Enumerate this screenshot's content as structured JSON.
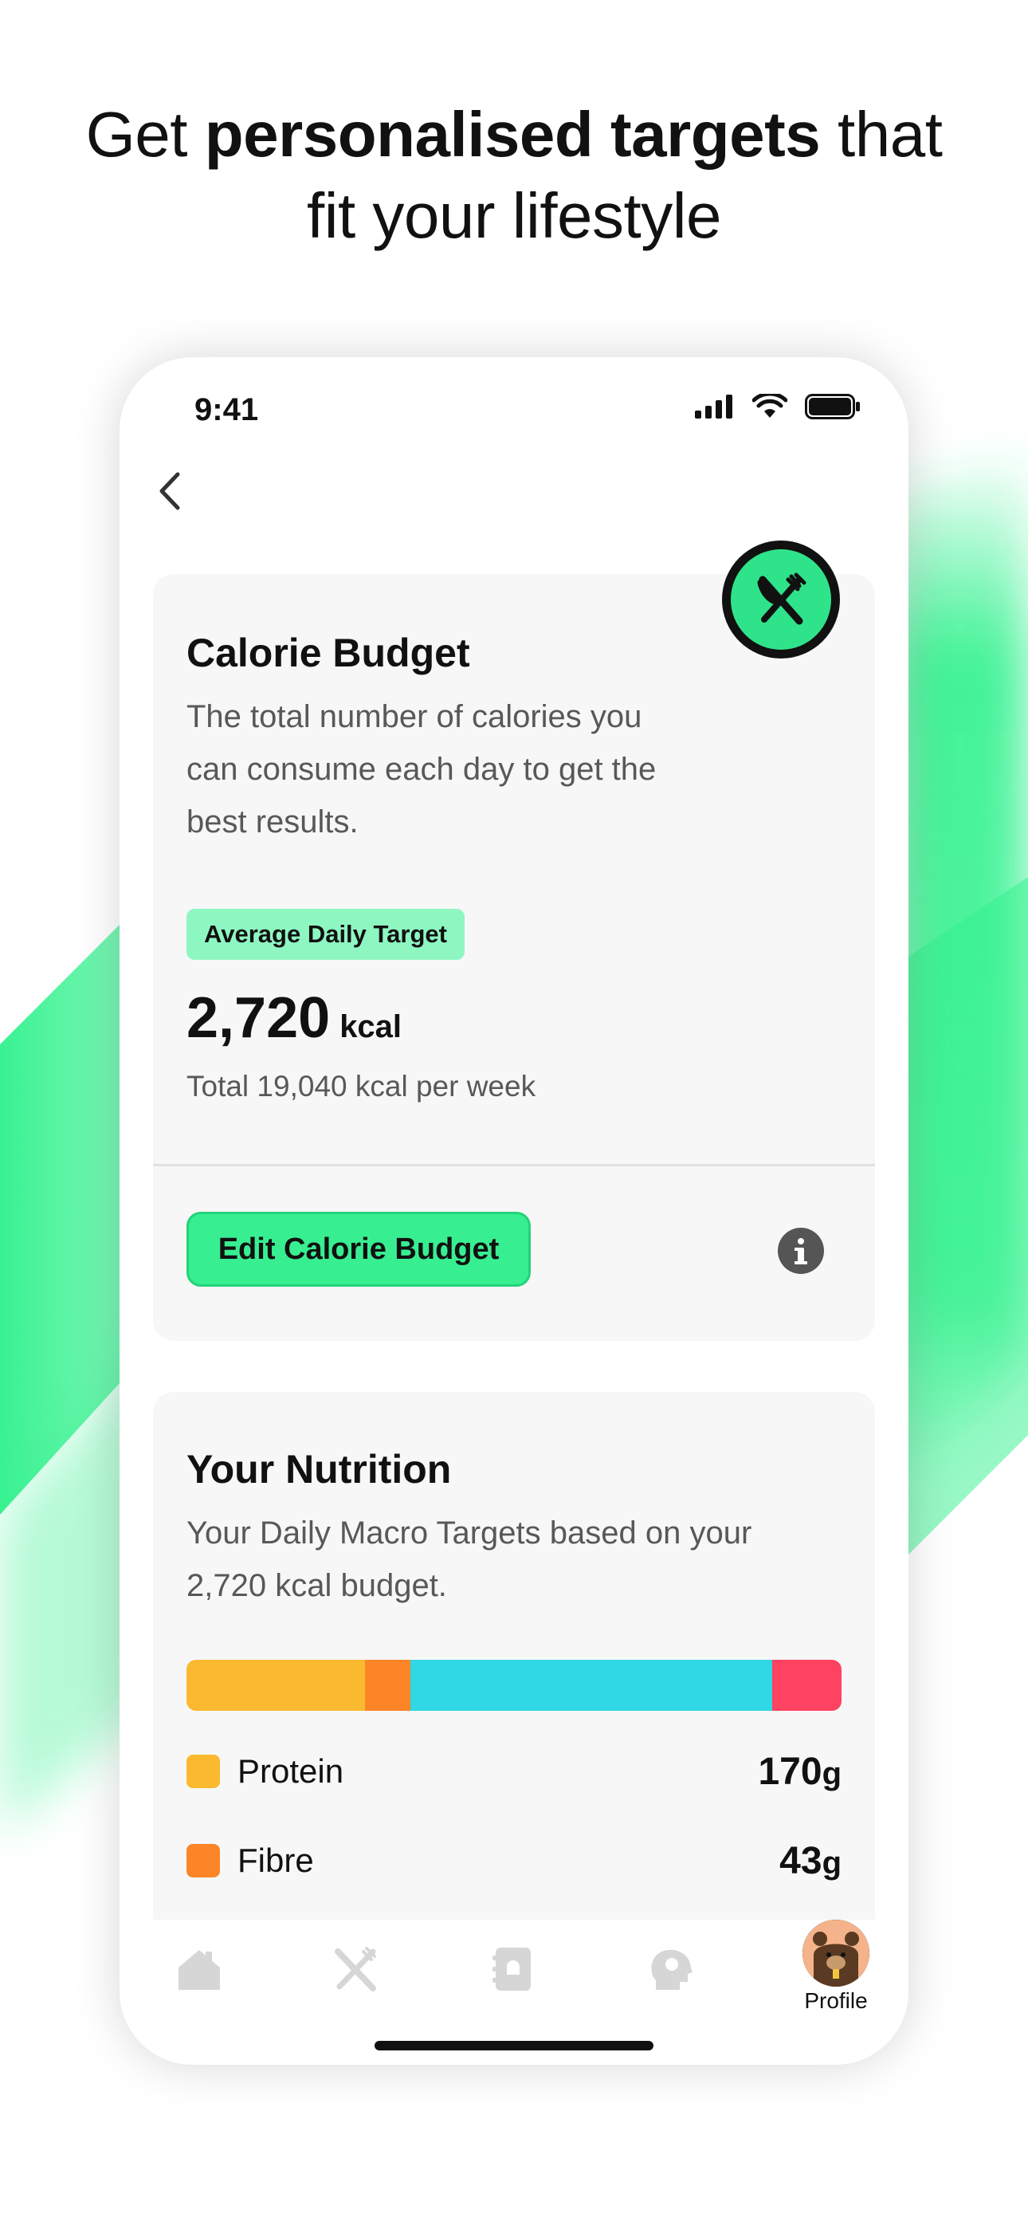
{
  "headline": {
    "pre": "Get ",
    "bold": "personalised targets",
    "post": " that",
    "line2": "fit your lifestyle"
  },
  "status": {
    "time": "9:41"
  },
  "colors": {
    "accent": "#37ef91",
    "pill": "#8ef7c1"
  },
  "calorie_card": {
    "title": "Calorie Budget",
    "description_lines": [
      "The total number of calories you",
      "can consume each day to get the",
      "best results."
    ],
    "pill": "Average Daily Target",
    "value": "2,720",
    "unit": "kcal",
    "weekly": "Total 19,040 kcal per week",
    "edit_button": "Edit Calorie Budget",
    "info_icon": "info-icon",
    "badge_icon": "cutlery-icon"
  },
  "nutrition_card": {
    "title": "Your Nutrition",
    "description_lines": [
      "Your Daily Macro Targets based on your",
      "2,720 kcal budget."
    ],
    "bar_segments": [
      {
        "color": "#fbb92f",
        "share": 0.272
      },
      {
        "color": "#fb8527",
        "share": 0.07
      },
      {
        "color": "#2fd8e4",
        "share": 0.552
      },
      {
        "color": "#fd4361",
        "share": 0.106
      }
    ],
    "macros": [
      {
        "name": "Protein",
        "value": "170",
        "unit": "g",
        "color": "#fbb92f"
      },
      {
        "name": "Fibre",
        "value": "43",
        "unit": "g",
        "color": "#fb8527"
      }
    ]
  },
  "tabbar": {
    "tabs": [
      "home-icon",
      "cutlery-icon",
      "recipe-book-icon",
      "head-icon"
    ],
    "profile_label": "Profile"
  }
}
